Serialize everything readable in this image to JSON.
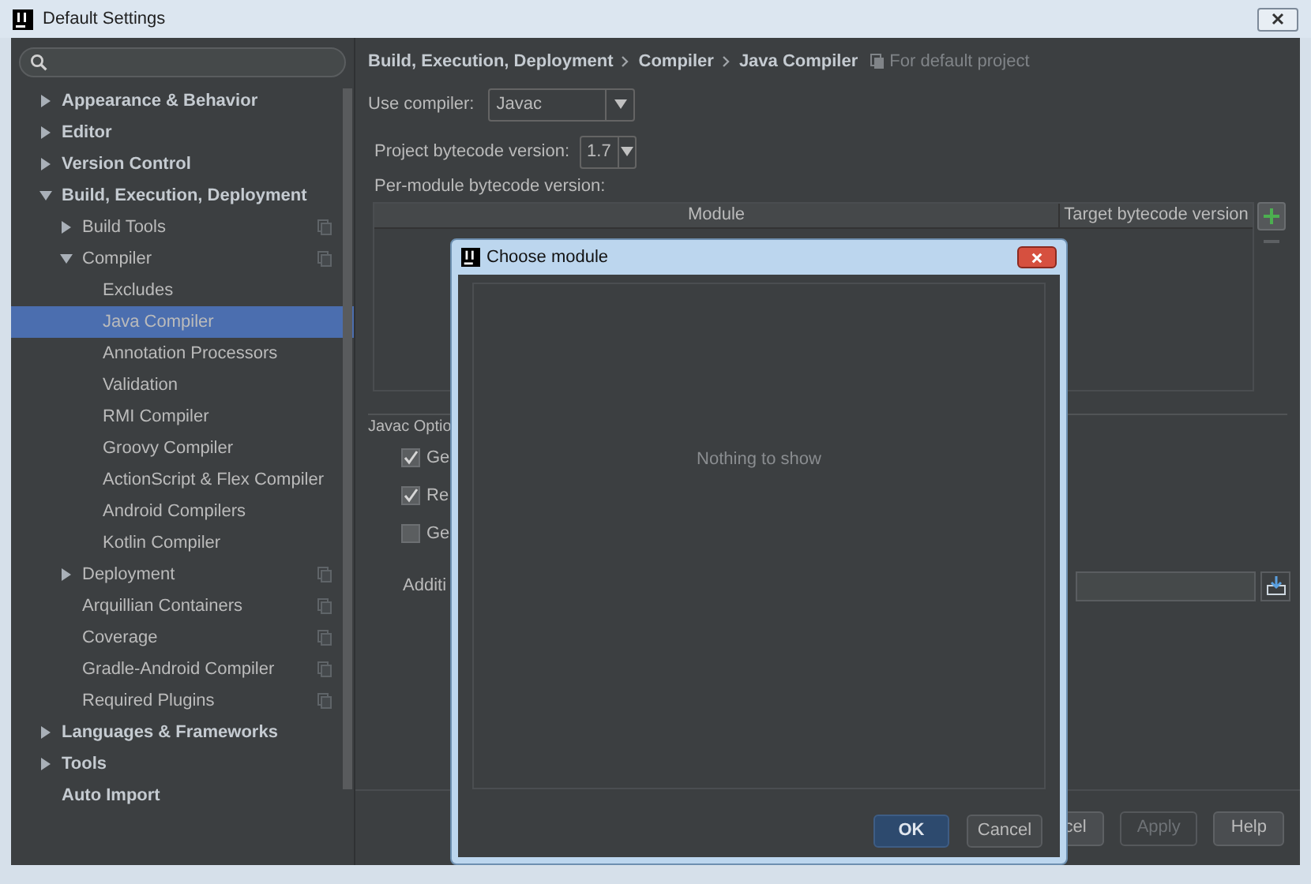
{
  "window": {
    "title": "Default Settings"
  },
  "sidebar": {
    "tree": [
      {
        "label": "Appearance & Behavior",
        "kind": "node",
        "expanded": false,
        "selected": false,
        "scoped": false
      },
      {
        "label": "Editor",
        "kind": "node",
        "expanded": false,
        "selected": false,
        "scoped": false
      },
      {
        "label": "Version Control",
        "kind": "node",
        "expanded": false,
        "selected": false,
        "scoped": false
      },
      {
        "label": "Build, Execution, Deployment",
        "kind": "node",
        "expanded": true,
        "selected": false,
        "scoped": false,
        "children": [
          {
            "label": "Build Tools",
            "kind": "node",
            "expanded": false,
            "selected": false,
            "scoped": true
          },
          {
            "label": "Compiler",
            "kind": "node",
            "expanded": true,
            "selected": false,
            "scoped": true,
            "children": [
              {
                "label": "Excludes",
                "kind": "leaf",
                "selected": false,
                "scoped": false
              },
              {
                "label": "Java Compiler",
                "kind": "leaf",
                "selected": true,
                "scoped": false
              },
              {
                "label": "Annotation Processors",
                "kind": "leaf",
                "selected": false,
                "scoped": false
              },
              {
                "label": "Validation",
                "kind": "leaf",
                "selected": false,
                "scoped": false
              },
              {
                "label": "RMI Compiler",
                "kind": "leaf",
                "selected": false,
                "scoped": false
              },
              {
                "label": "Groovy Compiler",
                "kind": "leaf",
                "selected": false,
                "scoped": false
              },
              {
                "label": "ActionScript & Flex Compiler",
                "kind": "leaf",
                "selected": false,
                "scoped": false
              },
              {
                "label": "Android Compilers",
                "kind": "leaf",
                "selected": false,
                "scoped": false
              },
              {
                "label": "Kotlin Compiler",
                "kind": "leaf",
                "selected": false,
                "scoped": false
              }
            ]
          },
          {
            "label": "Deployment",
            "kind": "node",
            "expanded": false,
            "selected": false,
            "scoped": true
          },
          {
            "label": "Arquillian Containers",
            "kind": "leaf",
            "selected": false,
            "scoped": true
          },
          {
            "label": "Coverage",
            "kind": "leaf",
            "selected": false,
            "scoped": true
          },
          {
            "label": "Gradle-Android Compiler",
            "kind": "leaf",
            "selected": false,
            "scoped": true
          },
          {
            "label": "Required Plugins",
            "kind": "leaf",
            "selected": false,
            "scoped": true
          }
        ]
      },
      {
        "label": "Languages & Frameworks",
        "kind": "node",
        "expanded": false,
        "selected": false,
        "scoped": false
      },
      {
        "label": "Tools",
        "kind": "node",
        "expanded": false,
        "selected": false,
        "scoped": false
      },
      {
        "label": "Auto Import",
        "kind": "leaf",
        "selected": false,
        "scoped": false
      }
    ]
  },
  "breadcrumb": [
    "Build, Execution, Deployment",
    "Compiler",
    "Java Compiler"
  ],
  "scope_note": "For default project",
  "compiler": {
    "label": "Use compiler:",
    "value": "Javac"
  },
  "bytecode": {
    "label": "Project bytecode version:",
    "value": "1.7"
  },
  "per_module": {
    "label": "Per-module bytecode version:",
    "columns": [
      "Module",
      "Target bytecode version"
    ]
  },
  "javac_options": {
    "title": "Javac Optio",
    "checkboxes": [
      {
        "label": "Ge",
        "checked": true
      },
      {
        "label": "Re",
        "checked": true
      },
      {
        "label": "Ge",
        "checked": false
      }
    ],
    "additional_label": "Additi"
  },
  "dialog": {
    "title": "Choose module",
    "empty_text": "Nothing to show",
    "buttons": [
      {
        "label": "OK",
        "default": true
      },
      {
        "label": "Cancel",
        "default": false
      }
    ]
  },
  "footer_buttons": [
    {
      "label": "cel",
      "disabled": false
    },
    {
      "label": "Apply",
      "disabled": true
    },
    {
      "label": "Help",
      "disabled": false
    }
  ]
}
